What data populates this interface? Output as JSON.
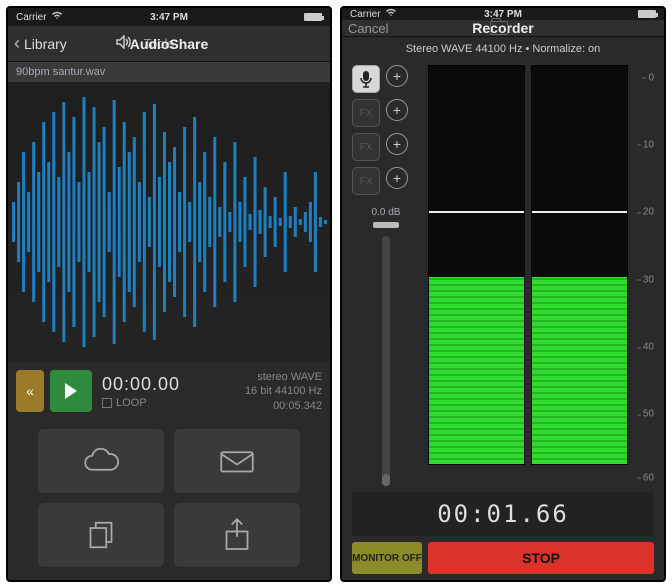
{
  "status": {
    "carrier": "Carrier",
    "time": "3:47 PM"
  },
  "left": {
    "nav": {
      "back": "Library",
      "title": "AudioShare",
      "tools": "Tools"
    },
    "file": {
      "name": "90bpm santur.wav"
    },
    "transport": {
      "time": "00:00.00",
      "loop": "LOOP"
    },
    "format": {
      "line1": "stereo WAVE",
      "line2": "16 bit 44100 Hz",
      "duration": "00:05.342"
    }
  },
  "right": {
    "nav": {
      "cancel": "Cancel",
      "title": "Recorder"
    },
    "info": "Stereo WAVE 44100 Hz • Normalize: on",
    "gain": {
      "label": "0.0 dB"
    },
    "sources": {
      "fx": "FX"
    },
    "scale": {
      "t0": "0",
      "t10": "10",
      "t20": "20",
      "t30": "30",
      "t40": "40",
      "t50": "50",
      "t60": "60"
    },
    "meter": {
      "left_pct": 47,
      "right_pct": 47
    },
    "time": "00:01.66",
    "buttons": {
      "monitor": "MONITOR OFF",
      "stop": "STOP"
    }
  }
}
